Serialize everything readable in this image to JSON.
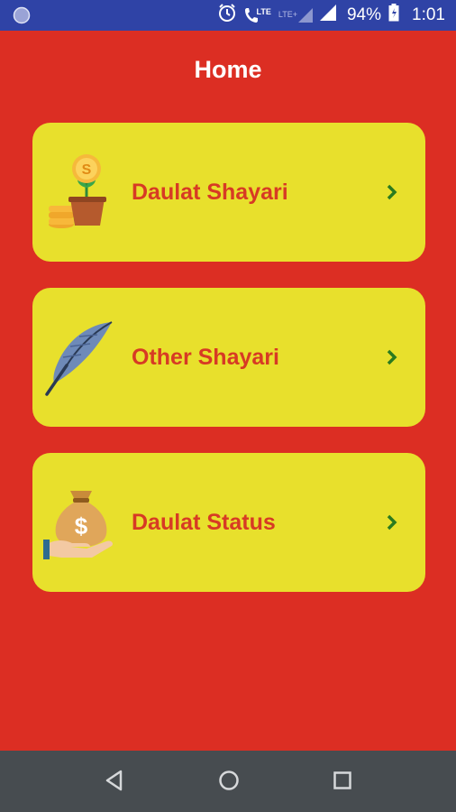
{
  "status_bar": {
    "battery_percent": "94%",
    "time": "1:01",
    "network_label_1": "LTE",
    "network_label_2": "LTE+",
    "icons": [
      "notification-dot-icon",
      "alarm-icon",
      "volte-call-icon",
      "signal-icon",
      "signal-icon",
      "battery-icon"
    ]
  },
  "header": {
    "title": "Home"
  },
  "menu": {
    "items": [
      {
        "label": "Daulat Shayari",
        "icon": "money-plant-icon"
      },
      {
        "label": "Other Shayari",
        "icon": "feather-icon"
      },
      {
        "label": "Daulat Status",
        "icon": "money-bag-hand-icon"
      }
    ]
  },
  "navigation": {
    "icons": [
      "back-icon",
      "home-icon",
      "recents-icon"
    ]
  },
  "colors": {
    "background": "#dc2e23",
    "status_bar": "#2f43a6",
    "card": "#e8e02c",
    "card_text": "#d73a24",
    "chevron": "#2b7a1e",
    "nav_bar": "#474c50"
  }
}
